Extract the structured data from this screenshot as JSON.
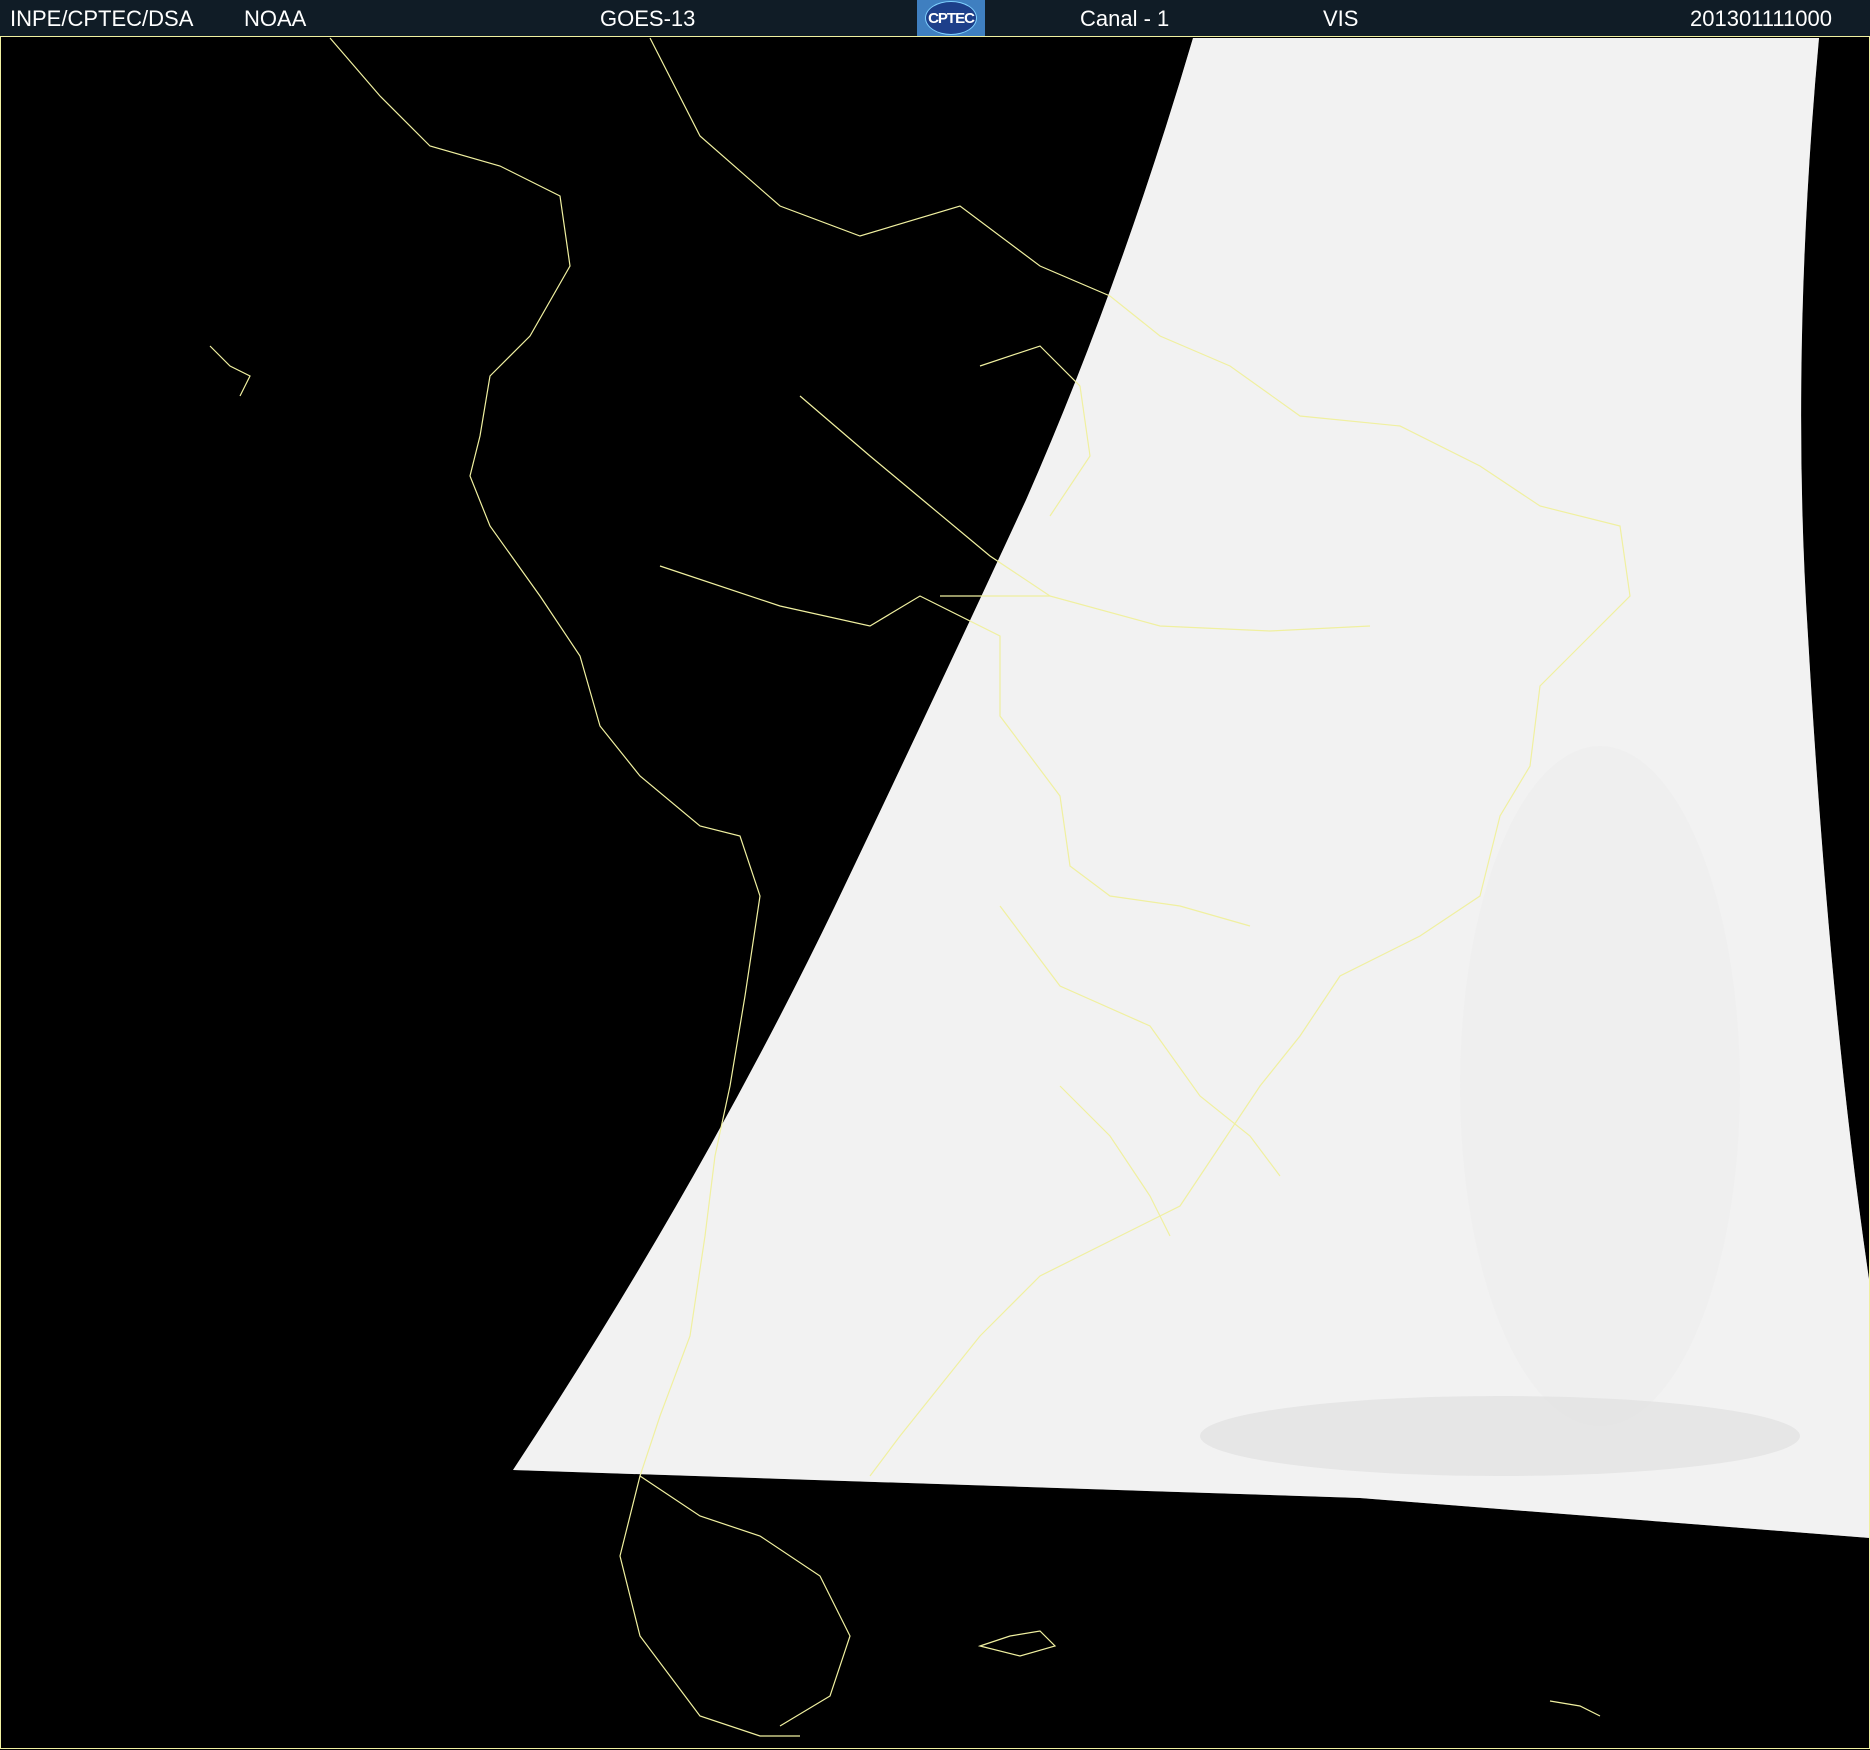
{
  "header": {
    "institution": "INPE/CPTEC/DSA",
    "agency": "NOAA",
    "satellite": "GOES-13",
    "logo_text": "CPTEC",
    "channel": "Canal - 1",
    "band": "VIS",
    "timestamp": "201301111000"
  },
  "colors": {
    "header_bg": "#101c26",
    "coastline": "#f0f0a0",
    "background": "#000000"
  }
}
